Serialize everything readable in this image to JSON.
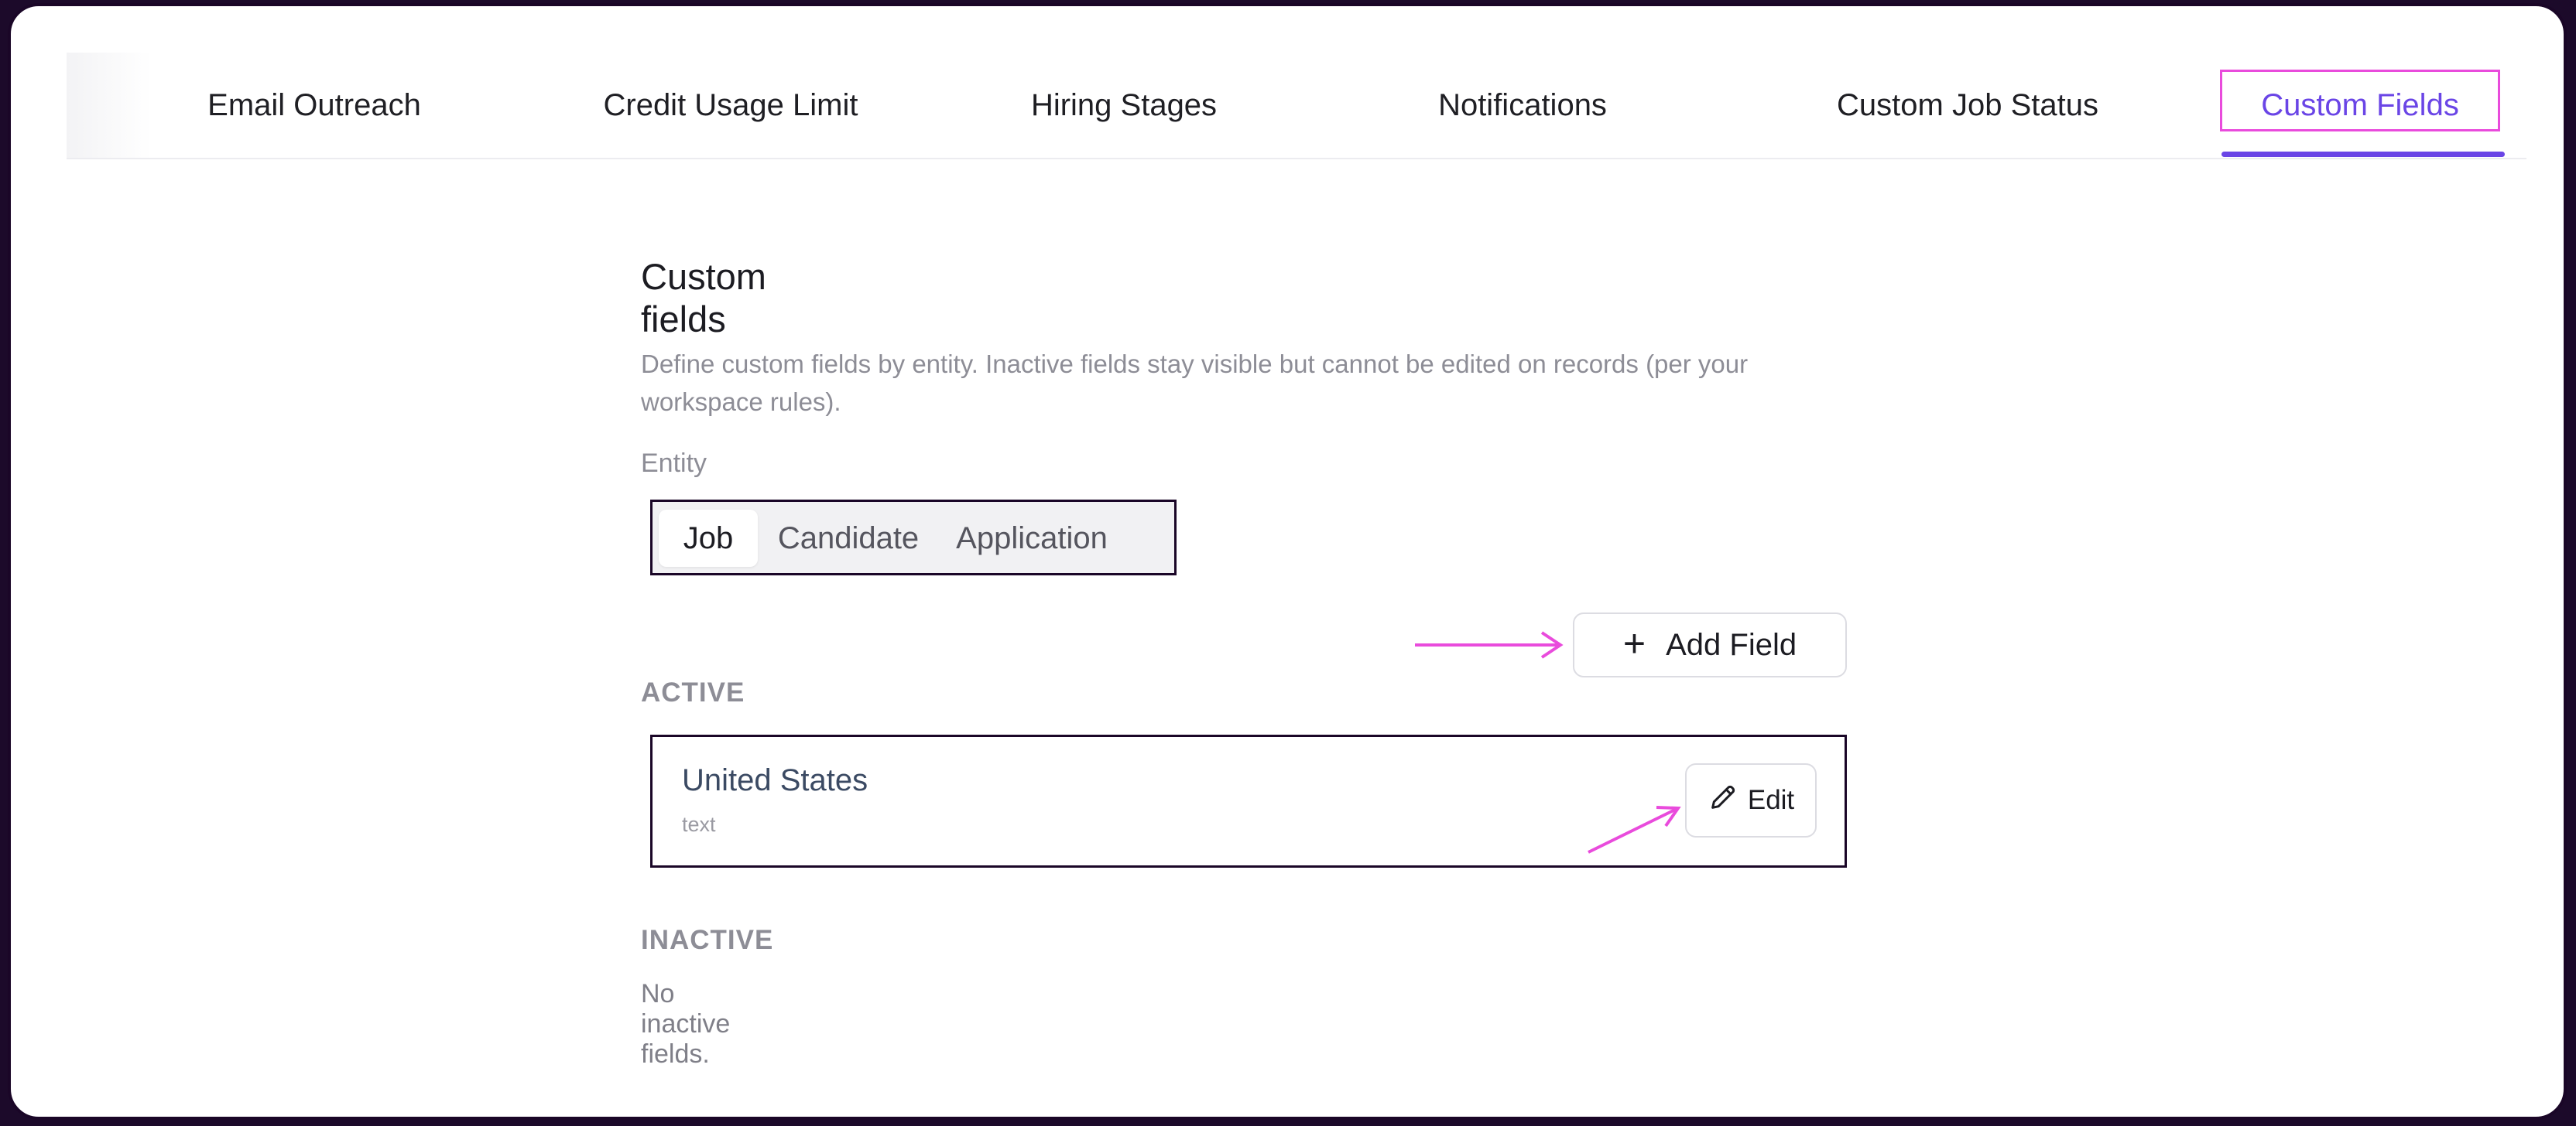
{
  "tabs": [
    {
      "label": "Email Outreach",
      "active": false
    },
    {
      "label": "Credit Usage Limit",
      "active": false
    },
    {
      "label": "Hiring Stages",
      "active": false
    },
    {
      "label": "Notifications",
      "active": false
    },
    {
      "label": "Custom Job Status",
      "active": false
    },
    {
      "label": "Custom Fields",
      "active": true
    }
  ],
  "section": {
    "title": "Custom fields",
    "description": "Define custom fields by entity. Inactive fields stay visible but cannot be edited on records (per your workspace rules).",
    "entity_label": "Entity",
    "entity_options": [
      "Job",
      "Candidate",
      "Application"
    ],
    "entity_selected": "Job",
    "add_field_label": "Add Field",
    "active_label": "ACTIVE",
    "active_fields": [
      {
        "name": "United States",
        "type": "text",
        "edit_label": "Edit"
      }
    ],
    "inactive_label": "INACTIVE",
    "inactive_empty": "No inactive fields."
  },
  "colors": {
    "accent": "#6a45e6",
    "annotation": "#e94bdc",
    "outline": "#1a0627"
  },
  "icons": {
    "add": "plus-icon",
    "edit": "pencil-icon"
  }
}
